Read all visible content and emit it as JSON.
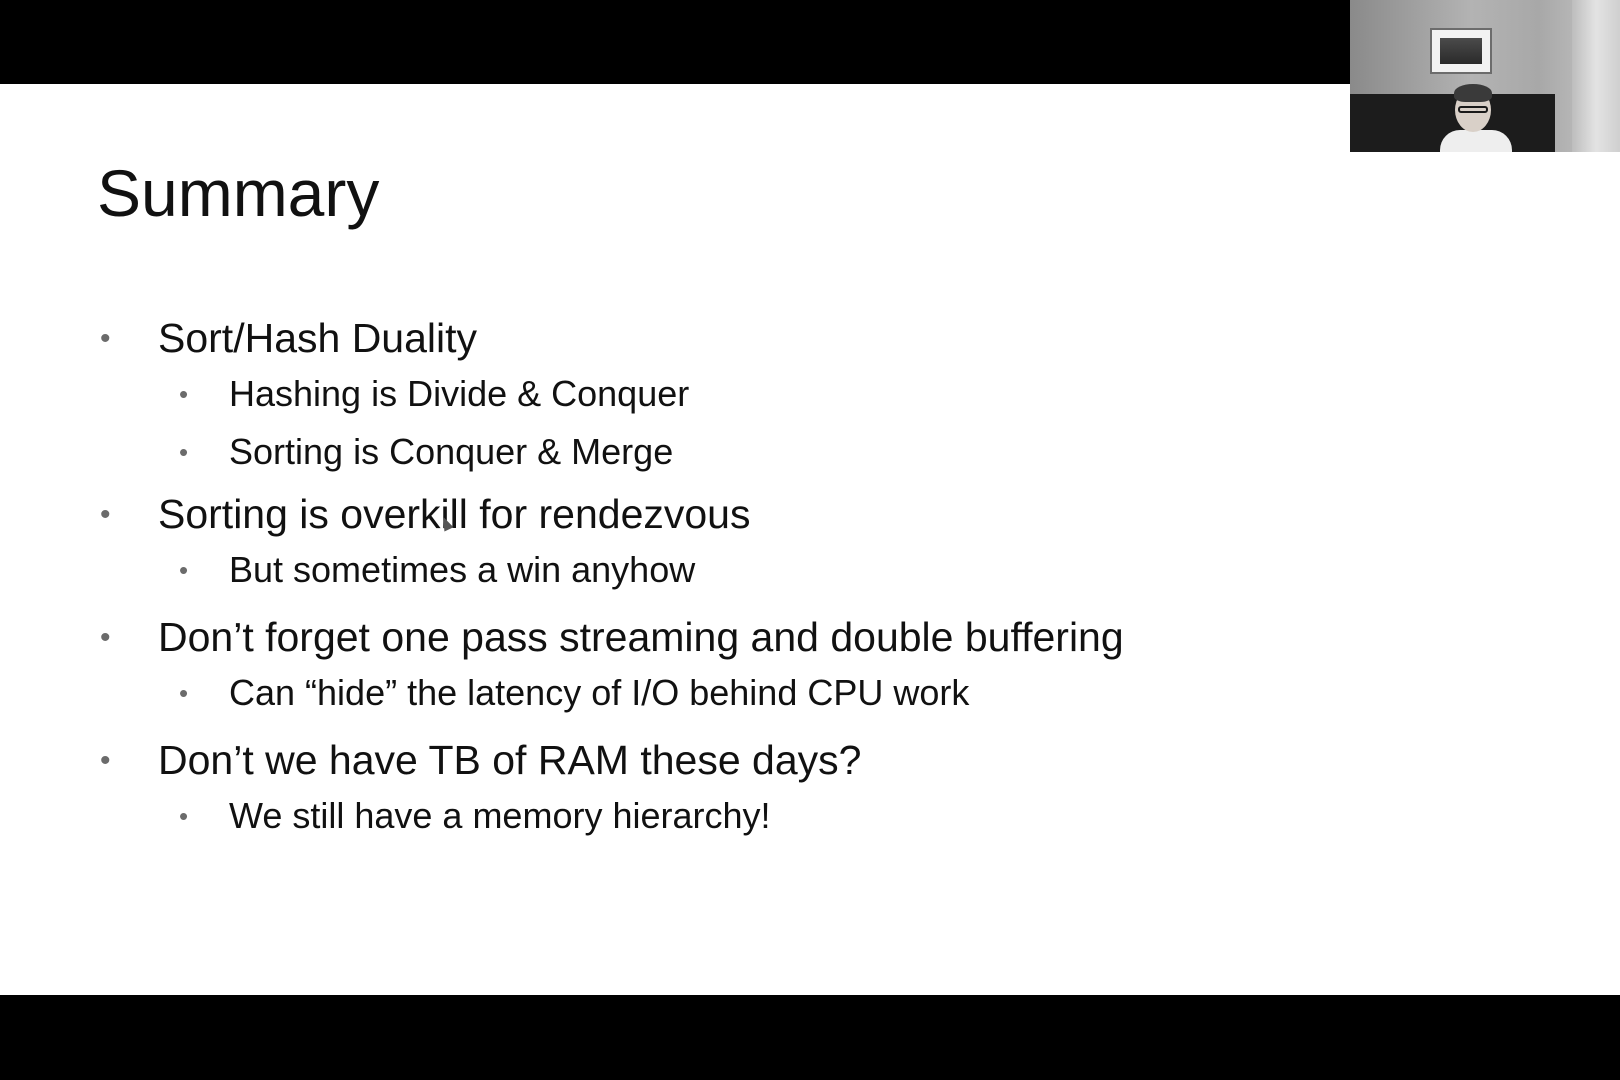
{
  "slide": {
    "title": "Summary",
    "bullets": [
      {
        "level": 1,
        "text": "Sort/Hash Duality"
      },
      {
        "level": 2,
        "text": "Hashing is Divide & Conquer"
      },
      {
        "level": 2,
        "text": "Sorting is Conquer & Merge"
      },
      {
        "level": 1,
        "text": "Sorting is overkill for rendezvous"
      },
      {
        "level": 2,
        "text": "But sometimes a win anyhow"
      },
      {
        "level": 1,
        "text": "Don’t forget one pass streaming and double buffering"
      },
      {
        "level": 2,
        "text": "Can “hide” the latency of I/O behind CPU work"
      },
      {
        "level": 1,
        "text": "Don’t we have TB of RAM these days?"
      },
      {
        "level": 2,
        "text": "We still have a memory hierarchy!"
      }
    ],
    "bullet_glyph": "•"
  },
  "colors": {
    "letterbox": "#000000",
    "slide_background": "#ffffff",
    "text": "#111111",
    "bullet_dot": "#6b6b6b"
  },
  "icons": {
    "cursor": "mouse-pointer-icon"
  }
}
